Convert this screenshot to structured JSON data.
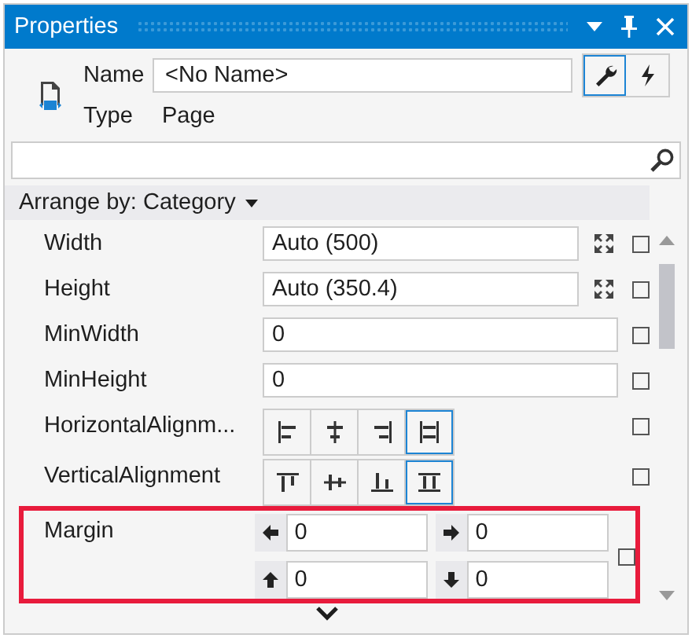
{
  "window": {
    "title": "Properties"
  },
  "header": {
    "name_label": "Name",
    "name_value": "<No Name>",
    "type_label": "Type",
    "type_value": "Page",
    "tabs": [
      {
        "kind": "properties",
        "selected": true
      },
      {
        "kind": "events",
        "selected": false
      }
    ]
  },
  "arrange_by": "Arrange by: Category",
  "properties": [
    {
      "kind": "text",
      "label": "Width",
      "value": "Auto (500)",
      "auto_icon": true,
      "checked": false
    },
    {
      "kind": "text",
      "label": "Height",
      "value": "Auto (350.4)",
      "auto_icon": true,
      "checked": false
    },
    {
      "kind": "text",
      "label": "MinWidth",
      "value": "0",
      "auto_icon": false,
      "checked": false
    },
    {
      "kind": "text",
      "label": "MinHeight",
      "value": "0",
      "auto_icon": false,
      "checked": false
    },
    {
      "kind": "halign",
      "label": "HorizontalAlignm...",
      "checked": false,
      "options": [
        {
          "selected": false
        },
        {
          "selected": false
        },
        {
          "selected": false
        },
        {
          "selected": true
        }
      ]
    },
    {
      "kind": "valign",
      "label": "VerticalAlignment",
      "checked": false,
      "options": [
        {
          "selected": false
        },
        {
          "selected": false
        },
        {
          "selected": false
        },
        {
          "selected": true
        }
      ]
    },
    {
      "kind": "margin",
      "label": "Margin",
      "highlighted": true,
      "checked": false,
      "values": [
        {
          "value": "0"
        },
        {
          "value": "0"
        },
        {
          "value": "0"
        },
        {
          "value": "0"
        }
      ]
    }
  ]
}
